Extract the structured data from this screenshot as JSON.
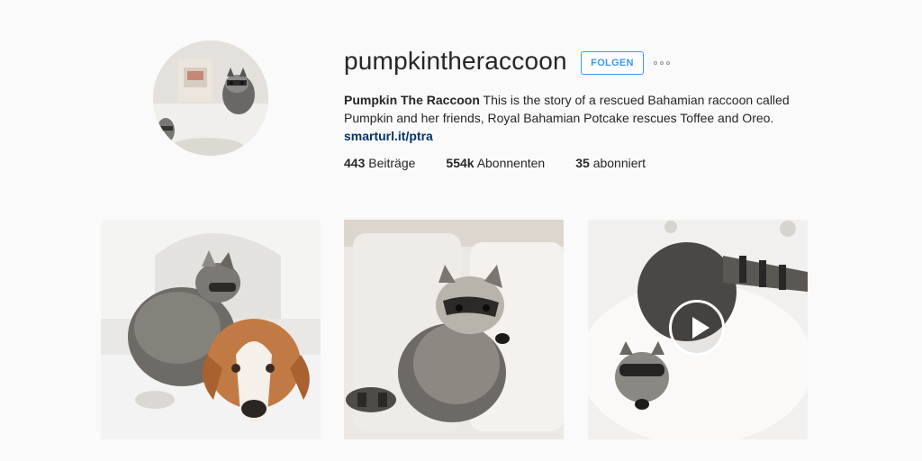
{
  "profile": {
    "username": "pumpkintheraccoon",
    "follow_label": "FOLGEN",
    "more_icon": "ellipsis-icon",
    "full_name": "Pumpkin The Raccoon",
    "bio_text": " This is the story of a rescued Bahamian raccoon called Pumpkin and her friends, Royal Bahamian Potcake rescues Toffee and Oreo.",
    "link": "smarturl.it/ptra"
  },
  "stats": [
    {
      "count": "443",
      "label": "Beiträge"
    },
    {
      "count": "554k",
      "label": "Abonnenten"
    },
    {
      "count": "35",
      "label": "abonniert"
    }
  ],
  "colors": {
    "accent": "#3897f0",
    "link": "#003569",
    "background": "#fafafa"
  },
  "posts": [
    {
      "kind": "photo"
    },
    {
      "kind": "photo"
    },
    {
      "kind": "video",
      "overlay_icon": "play-icon"
    }
  ]
}
